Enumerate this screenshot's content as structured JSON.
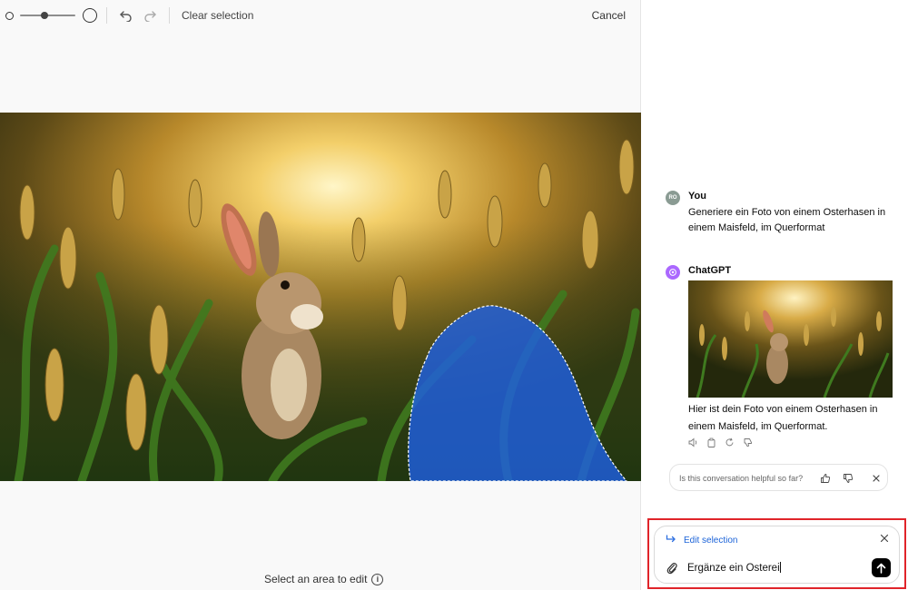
{
  "toolbar": {
    "clear_label": "Clear selection",
    "cancel_label": "Cancel",
    "brush_size_level": 0.45
  },
  "editor": {
    "footer_hint": "Select an area to edit",
    "image_description_icon": "easter-bunny-cornfield-image"
  },
  "chat": {
    "user": {
      "avatar_initials": "RO",
      "sender": "You",
      "text": "Generiere ein Foto von einem Osterhasen in einem Maisfeld, im Querformat"
    },
    "assistant": {
      "sender": "ChatGPT",
      "text": "Hier ist dein Foto von einem Osterhasen in einem Maisfeld, im Querformat.",
      "actions": [
        "speaker-icon",
        "copy-icon",
        "regenerate-icon",
        "thumbs-down-icon"
      ]
    },
    "feedback": {
      "question": "Is this conversation helpful so far?"
    }
  },
  "composer": {
    "edit_selection_label": "Edit selection",
    "input_value": "Ergänze ein Osterei"
  },
  "colors": {
    "accent_blue": "#1b63d8",
    "selection_blue": "#1f5fe0",
    "highlight_red": "#e0242a",
    "gpt_avatar": "#ab68ff"
  }
}
